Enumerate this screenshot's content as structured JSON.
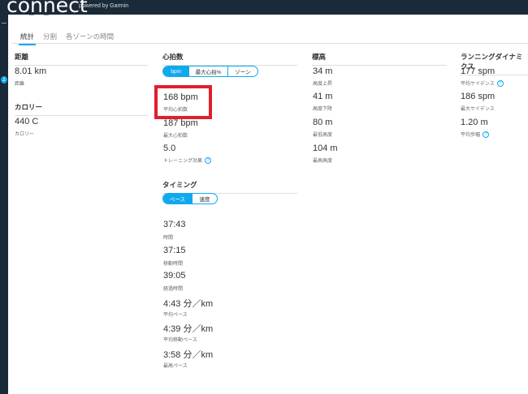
{
  "header": {
    "logo": "connect",
    "logo_sub": "powered by Garmin"
  },
  "rail": {
    "badge": "2"
  },
  "tabs": [
    {
      "label": "統計",
      "active": true
    },
    {
      "label": "分割",
      "active": false
    },
    {
      "label": "各ゾーンの時間",
      "active": false
    }
  ],
  "col1": {
    "distance": {
      "title": "距離",
      "value": "8.01 km",
      "label": "距離"
    },
    "calories": {
      "title": "カロリー",
      "value": "440 C",
      "label": "カロリー"
    }
  },
  "heart": {
    "title": "心拍数",
    "toggle": [
      "bpm",
      "最大心拍%",
      "ゾーン"
    ],
    "avg": {
      "value": "168 bpm",
      "label": "平均心拍数"
    },
    "max": {
      "value": "187 bpm",
      "label": "最大心拍数"
    },
    "te": {
      "value": "5.0",
      "label": "トレーニング効果"
    }
  },
  "timing": {
    "title": "タイミング",
    "toggle": [
      "ペース",
      "速度"
    ],
    "items": [
      {
        "value": "37:43",
        "label": "時間"
      },
      {
        "value": "37:15",
        "label": "移動時間"
      },
      {
        "value": "39:05",
        "label": "経過時間"
      },
      {
        "value": "4:43 分／km",
        "label": "平均ペース"
      },
      {
        "value": "4:39 分／km",
        "label": "平均移動ペース"
      },
      {
        "value": "3:58 分／km",
        "label": "最高ペース"
      }
    ]
  },
  "elevation": {
    "title": "標高",
    "items": [
      {
        "value": "34 m",
        "label": "高度上昇"
      },
      {
        "value": "41 m",
        "label": "高度下降"
      },
      {
        "value": "80 m",
        "label": "最低高度"
      },
      {
        "value": "104 m",
        "label": "最高高度"
      }
    ]
  },
  "dynamics": {
    "title": "ランニングダイナミクス",
    "items": [
      {
        "value": "177 spm",
        "label": "平均ケイデンス"
      },
      {
        "value": "186 spm",
        "label": "最大ケイデンス"
      },
      {
        "value": "1.20 m",
        "label": "平均歩幅"
      }
    ]
  },
  "help_glyph": "?"
}
